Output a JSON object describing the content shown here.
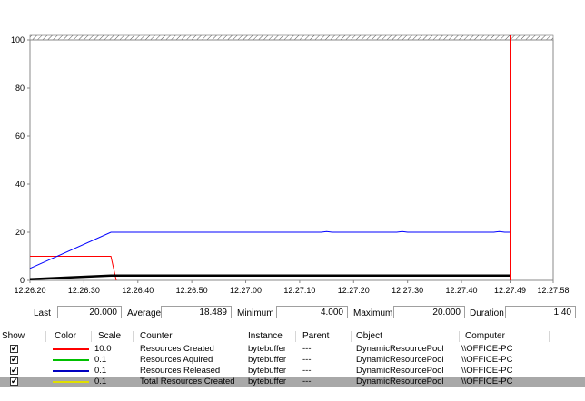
{
  "chart_data": {
    "type": "line",
    "y_ticks": [
      "0",
      "20",
      "40",
      "60",
      "80",
      "100"
    ],
    "x_ticks": [
      "12:26:20",
      "12:26:30",
      "12:26:40",
      "12:26:50",
      "12:27:00",
      "12:27:10",
      "12:27:20",
      "12:27:30",
      "12:27:40",
      "12:27:49",
      "12:27:58"
    ],
    "ylim": [
      0,
      100
    ],
    "grid": false,
    "current_time_marker": "12:27:49",
    "series": [
      {
        "name": "Resources Created",
        "color": "#ff0000",
        "points": [
          [
            0,
            10
          ],
          [
            15,
            10
          ],
          [
            16,
            0
          ]
        ]
      },
      {
        "name": "Resources Released",
        "color": "#0000ff",
        "points": [
          [
            0,
            5
          ],
          [
            15,
            20
          ],
          [
            20,
            20
          ],
          [
            30,
            20
          ],
          [
            40,
            20
          ],
          [
            50,
            20
          ],
          [
            54,
            20
          ],
          [
            55,
            20.3
          ],
          [
            56,
            20
          ],
          [
            60,
            20
          ],
          [
            68,
            20
          ],
          [
            69,
            20.3
          ],
          [
            70,
            20
          ],
          [
            78,
            20
          ],
          [
            80,
            20
          ],
          [
            86,
            20
          ],
          [
            87,
            20.3
          ],
          [
            88,
            20
          ],
          [
            90,
            20
          ],
          [
            91,
            20
          ],
          [
            92,
            20.3
          ],
          [
            93,
            20
          ],
          [
            99,
            20.3
          ],
          [
            100,
            20
          ],
          [
            102,
            20
          ],
          [
            104,
            20
          ],
          [
            106,
            20
          ],
          [
            108,
            20
          ],
          [
            110,
            20
          ],
          [
            112,
            20
          ],
          [
            114,
            20
          ],
          [
            116,
            20
          ],
          [
            117,
            20.3
          ],
          [
            118,
            20
          ],
          [
            120,
            20
          ],
          [
            122,
            20
          ],
          [
            124,
            20
          ],
          [
            126,
            20
          ],
          [
            128,
            20
          ],
          [
            130,
            20
          ],
          [
            132,
            20
          ],
          [
            134,
            20
          ],
          [
            136,
            20
          ],
          [
            138,
            20
          ],
          [
            140,
            20
          ],
          [
            142,
            20
          ],
          [
            144,
            20
          ],
          [
            146,
            20
          ],
          [
            148,
            20
          ],
          [
            150,
            20
          ],
          [
            152,
            20
          ],
          [
            154,
            20
          ],
          [
            156,
            20
          ],
          [
            158,
            20
          ],
          [
            160,
            20
          ],
          [
            162,
            20
          ],
          [
            164,
            20
          ],
          [
            166,
            20
          ],
          [
            168,
            20
          ],
          [
            170,
            20
          ],
          [
            172,
            20
          ],
          [
            174,
            20
          ],
          [
            176,
            20
          ],
          [
            178,
            20
          ],
          [
            180,
            20
          ],
          [
            182,
            20
          ],
          [
            184,
            20
          ],
          [
            186,
            20
          ],
          [
            188,
            20
          ],
          [
            190,
            20
          ],
          [
            192,
            20
          ],
          [
            194,
            20
          ],
          [
            196,
            20
          ],
          [
            198,
            20
          ],
          [
            200,
            20
          ],
          [
            202,
            20
          ],
          [
            204,
            20
          ],
          [
            206,
            20
          ],
          [
            208,
            20
          ],
          [
            210,
            20
          ],
          [
            212,
            20
          ],
          [
            214,
            20
          ],
          [
            216,
            20
          ],
          [
            218,
            20
          ],
          [
            220,
            20
          ],
          [
            222,
            20
          ],
          [
            224,
            20
          ],
          [
            226,
            20
          ],
          [
            228,
            20
          ],
          [
            230,
            20
          ],
          [
            232,
            20
          ],
          [
            234,
            20
          ],
          [
            236,
            20
          ],
          [
            238,
            20
          ],
          [
            240,
            20
          ],
          [
            242,
            20
          ],
          [
            244,
            20
          ],
          [
            246,
            20
          ],
          [
            248,
            20
          ],
          [
            250,
            20
          ],
          [
            252,
            20
          ],
          [
            254,
            20
          ],
          [
            256,
            20
          ],
          [
            258,
            20
          ],
          [
            260,
            20
          ],
          [
            262,
            20
          ],
          [
            264,
            20
          ],
          [
            266,
            20
          ],
          [
            268,
            20
          ],
          [
            270,
            20
          ],
          [
            272,
            20
          ],
          [
            274,
            20
          ],
          [
            276,
            20
          ],
          [
            278,
            20
          ],
          [
            280,
            20
          ],
          [
            282,
            20
          ],
          [
            284,
            20
          ],
          [
            286,
            20
          ],
          [
            288,
            20
          ],
          [
            289,
            20
          ]
        ]
      },
      {
        "name": "Total Resources Created",
        "color": "#000000",
        "points": [
          [
            0,
            0.5
          ],
          [
            15,
            2
          ],
          [
            89,
            2
          ]
        ]
      }
    ]
  },
  "stats": {
    "last_label": "Last",
    "last_value": "20.000",
    "average_label": "Average",
    "average_value": "18.489",
    "minimum_label": "Minimum",
    "minimum_value": "4.000",
    "maximum_label": "Maximum",
    "maximum_value": "20.000",
    "duration_label": "Duration",
    "duration_value": "1:40"
  },
  "legend": {
    "headers": {
      "show": "Show",
      "color": "Color",
      "scale": "Scale",
      "counter": "Counter",
      "instance": "Instance",
      "parent": "Parent",
      "object": "Object",
      "computer": "Computer"
    },
    "rows": [
      {
        "checked": "✔",
        "color": "#ff0000",
        "scale": "10.0",
        "counter": "Resources Created",
        "instance": "bytebuffer",
        "parent": "---",
        "object": "DynamicResourcePool",
        "computer": "\\\\OFFICE-PC"
      },
      {
        "checked": "✔",
        "color": "#00c000",
        "scale": "0.1",
        "counter": "Resources Aquired",
        "instance": "bytebuffer",
        "parent": "---",
        "object": "DynamicResourcePool",
        "computer": "\\\\OFFICE-PC"
      },
      {
        "checked": "✔",
        "color": "#0000c0",
        "scale": "0.1",
        "counter": "Resources Released",
        "instance": "bytebuffer",
        "parent": "---",
        "object": "DynamicResourcePool",
        "computer": "\\\\OFFICE-PC"
      },
      {
        "checked": "✔",
        "color": "#e0e000",
        "scale": "0.1",
        "counter": "Total Resources Created",
        "instance": "bytebuffer",
        "parent": "---",
        "object": "DynamicResourcePool",
        "computer": "\\\\OFFICE-PC"
      }
    ]
  }
}
